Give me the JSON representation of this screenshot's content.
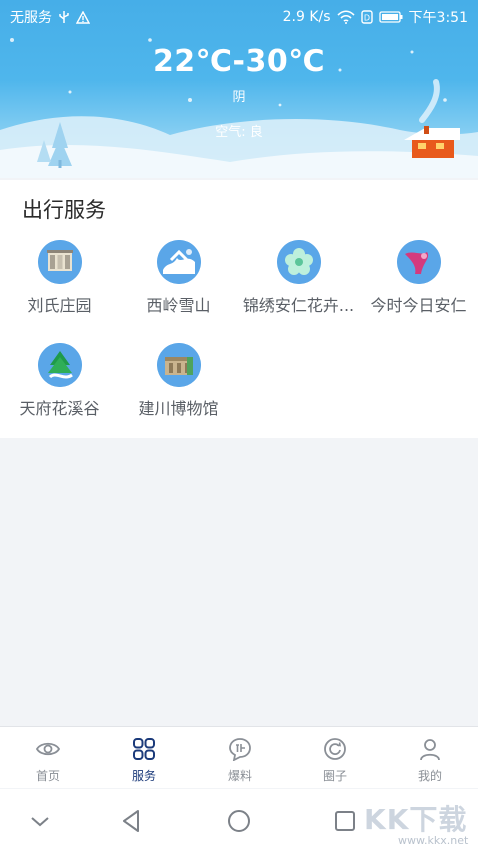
{
  "status_bar": {
    "carrier": "无服务",
    "speed": "2.9 K/s",
    "time": "下午3:51",
    "icons": [
      "usb-icon",
      "warning-icon",
      "wifi-icon",
      "data-icon",
      "battery-icon"
    ]
  },
  "weather": {
    "temperature": "22℃-30℃",
    "condition": "阴",
    "air_quality": "空气: 良"
  },
  "services": {
    "title": "出行服务",
    "items": [
      {
        "label": "刘氏庄园",
        "icon": "manor-icon"
      },
      {
        "label": "西岭雪山",
        "icon": "snow-mountain-icon"
      },
      {
        "label": "锦绣安仁花卉...",
        "icon": "flower-icon"
      },
      {
        "label": "今时今日安仁",
        "icon": "ribbon-icon"
      },
      {
        "label": "天府花溪谷",
        "icon": "valley-icon"
      },
      {
        "label": "建川博物馆",
        "icon": "museum-icon"
      }
    ]
  },
  "tabbar": {
    "tabs": [
      {
        "label": "首页",
        "icon": "eye-icon",
        "active": false
      },
      {
        "label": "服务",
        "icon": "grid-icon",
        "active": true
      },
      {
        "label": "爆料",
        "icon": "chat-icon",
        "active": false
      },
      {
        "label": "圈子",
        "icon": "circle-icon",
        "active": false
      },
      {
        "label": "我的",
        "icon": "user-icon",
        "active": false
      }
    ]
  },
  "watermark": {
    "text": "KK下载",
    "url": "www.kkx.net"
  },
  "colors": {
    "header_top": "#46aee8",
    "active_tab": "#1b3a7a",
    "inactive_tab": "#8a8f96",
    "service_icon_bg": "#5aa6e8"
  }
}
